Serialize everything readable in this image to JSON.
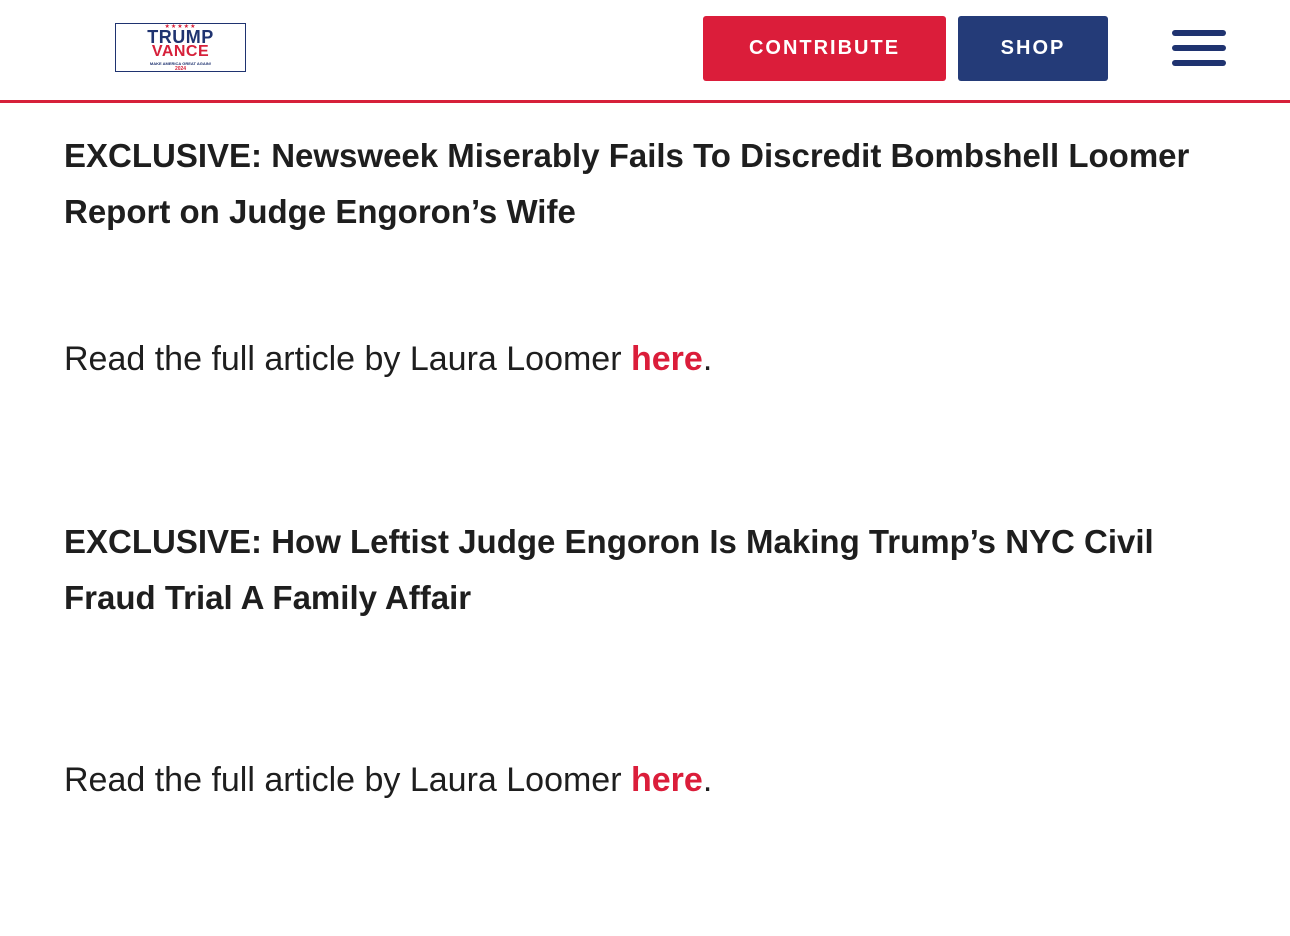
{
  "header": {
    "logo": {
      "stars": "★★★★★",
      "line1": "TRUMP",
      "line2": "VANCE",
      "tagline": "MAKE AMERICA GREAT AGAIN!",
      "year": "2024"
    },
    "contribute_label": "CONTRIBUTE",
    "shop_label": "SHOP",
    "menu_icon": "hamburger-menu-icon"
  },
  "articles": [
    {
      "headline": "EXCLUSIVE: Newsweek Miserably Fails To Discredit Bombshell Loomer Report on Judge Engoron’s Wife",
      "read_prefix": "Read the full article by Laura Loomer ",
      "link_label": "here",
      "read_suffix": "."
    },
    {
      "headline": "EXCLUSIVE: How Leftist Judge Engoron Is Making Trump’s NYC Civil Fraud Trial A Family Affair",
      "read_prefix": "Read the full article by Laura Loomer ",
      "link_label": "here",
      "read_suffix": "."
    }
  ],
  "colors": {
    "accent_red": "#db1d3a",
    "navy": "#243b78",
    "text": "#1e1e1e"
  }
}
